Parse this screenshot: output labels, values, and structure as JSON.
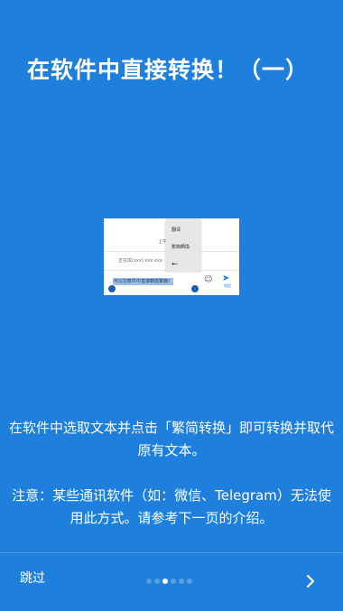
{
  "page": {
    "title": "在软件中直接转换！（一）",
    "description": "在软件中选取文本并点击「繁简转换」即可转换并取代原有文本。",
    "note": "注意：某些通讯软件（如：微信、Telegram）无法使用此方式。请参考下一页的介绍。"
  },
  "preview": {
    "popup_items": [
      "翻译",
      "繁簡轉換"
    ],
    "top_text": "上午",
    "phone_text": "正在與(xxx) xxx-xxx",
    "selected_text": "可以在軟件中直接轉換繁簡！",
    "send_label": "短信",
    "icons": [
      "back-arrow-icon",
      "emoji-icon",
      "send-icon"
    ]
  },
  "footer": {
    "skip_label": "跳过",
    "page_count": 6,
    "current_page": 3,
    "next_icon": "chevron-right-icon"
  },
  "colors": {
    "background": "#1e80dc",
    "text": "#ffffff",
    "dot_inactive": "#5b9ee0",
    "dot_active": "#ffffff"
  }
}
